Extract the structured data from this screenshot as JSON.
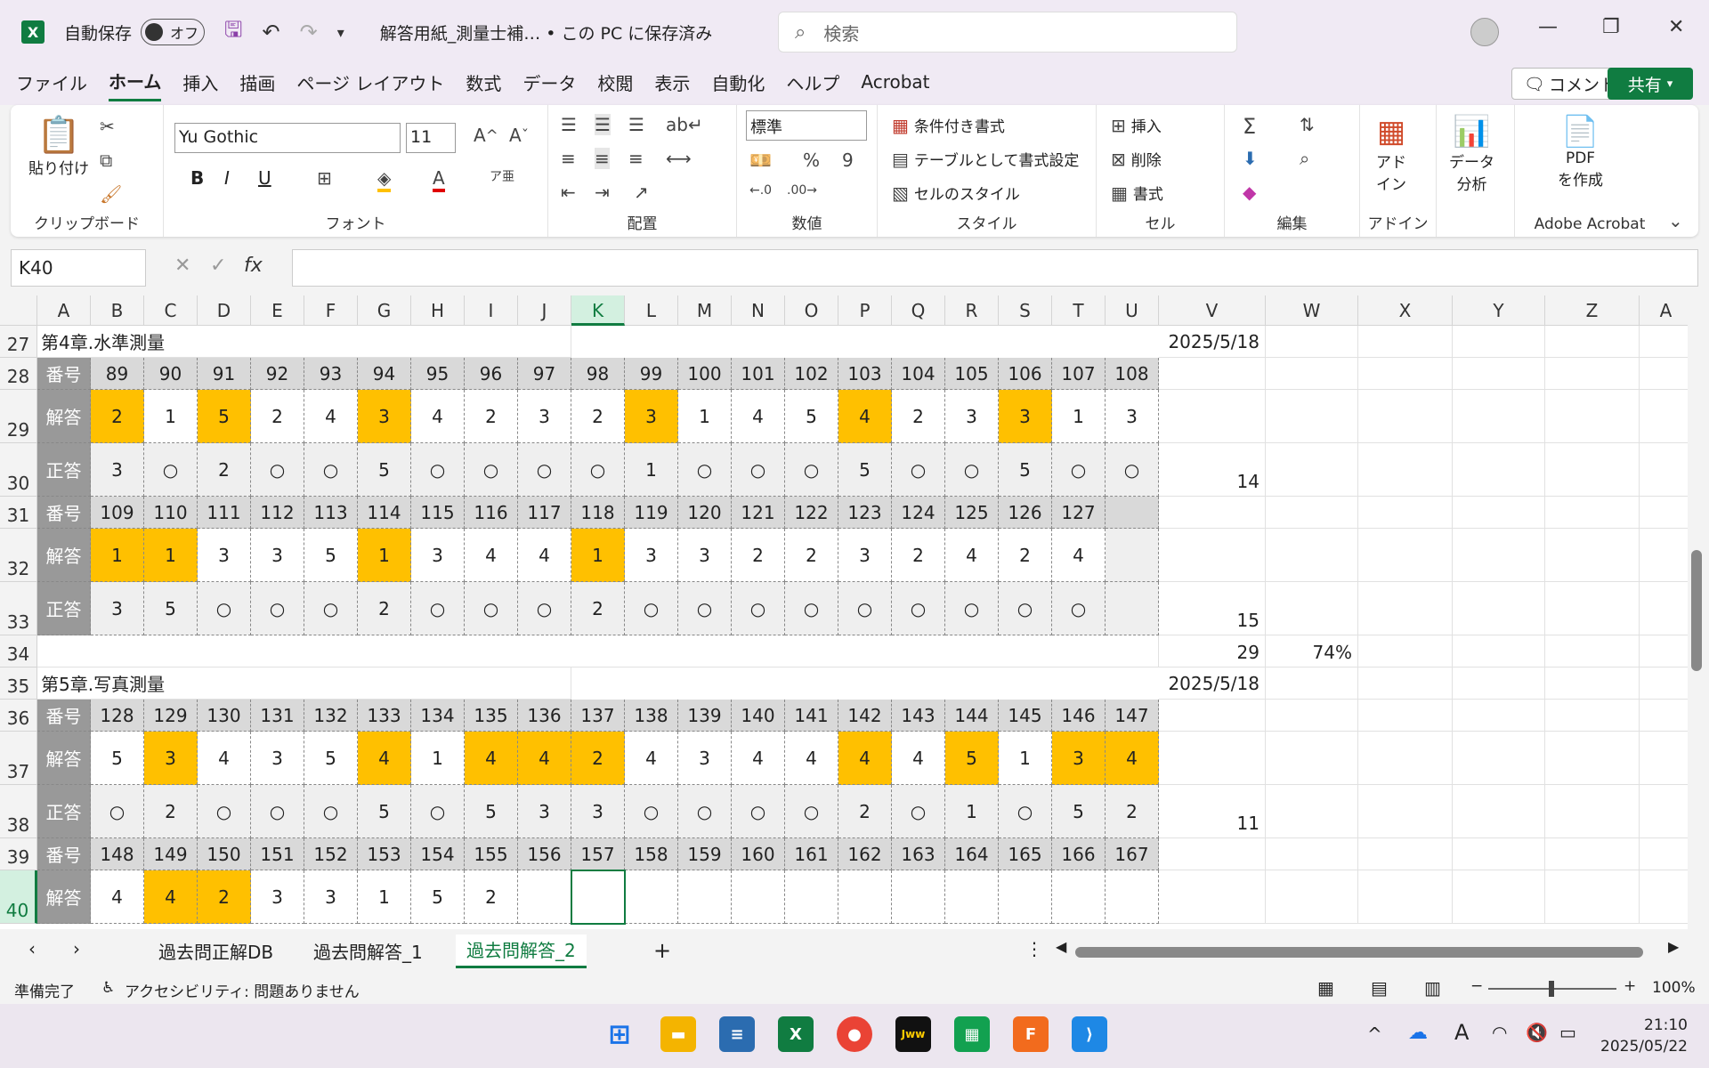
{
  "titlebar": {
    "app_icon": "X",
    "autosave_label": "自動保存",
    "autosave_state": "オフ",
    "doc_title": "解答用紙_測量士補… • この PC に保存済み",
    "search_placeholder": "検索"
  },
  "menu": {
    "items": [
      "ファイル",
      "ホーム",
      "挿入",
      "描画",
      "ページ レイアウト",
      "数式",
      "データ",
      "校閲",
      "表示",
      "自動化",
      "ヘルプ",
      "Acrobat"
    ],
    "active": "ホーム",
    "comment_label": "コメント",
    "share_label": "共有"
  },
  "ribbon": {
    "clipboard": {
      "paste": "貼り付け",
      "label": "クリップボード"
    },
    "font": {
      "name": "Yu Gothic",
      "size": "11",
      "label": "フォント"
    },
    "alignment": {
      "label": "配置"
    },
    "number": {
      "format": "標準",
      "label": "数値"
    },
    "styles": {
      "conditional": "条件付き書式",
      "table": "テーブルとして書式設定",
      "cell_styles": "セルのスタイル",
      "label": "スタイル"
    },
    "cells": {
      "insert": "挿入",
      "delete": "削除",
      "format": "書式",
      "label": "セル"
    },
    "editing": {
      "label": "編集"
    },
    "addins": {
      "btn1": "アド",
      "btn2": "イン",
      "label": "アドイン"
    },
    "analysis": {
      "btn1": "データ",
      "btn2": "分析"
    },
    "acrobat": {
      "btn1": "PDF",
      "btn2": "を作成",
      "label": "Adobe Acrobat"
    }
  },
  "formula_bar": {
    "name_box": "K40",
    "fx": "fx",
    "formula": ""
  },
  "columns": [
    "A",
    "B",
    "C",
    "D",
    "E",
    "F",
    "G",
    "H",
    "I",
    "J",
    "K",
    "L",
    "M",
    "N",
    "O",
    "P",
    "Q",
    "R",
    "S",
    "T",
    "U",
    "V",
    "W",
    "X",
    "Y",
    "Z",
    "A"
  ],
  "selected_column": "K",
  "rows": {
    "r27": {
      "num": "27",
      "title": "第4章.水準測量",
      "date": "2025/5/18"
    },
    "r28": {
      "num": "28",
      "label": "番号",
      "values": [
        "89",
        "90",
        "91",
        "92",
        "93",
        "94",
        "95",
        "96",
        "97",
        "98",
        "99",
        "100",
        "101",
        "102",
        "103",
        "104",
        "105",
        "106",
        "107",
        "108"
      ]
    },
    "r29": {
      "num": "29",
      "label": "解答",
      "values": [
        "2",
        "1",
        "5",
        "2",
        "4",
        "3",
        "4",
        "2",
        "3",
        "2",
        "3",
        "1",
        "4",
        "5",
        "4",
        "2",
        "3",
        "3",
        "1",
        "3"
      ]
    },
    "r30": {
      "num": "30",
      "label": "正答",
      "values": [
        "3",
        "○",
        "2",
        "○",
        "○",
        "5",
        "○",
        "○",
        "○",
        "○",
        "1",
        "○",
        "○",
        "○",
        "5",
        "○",
        "○",
        "5",
        "○",
        "○"
      ],
      "v": "14"
    },
    "r31": {
      "num": "31",
      "label": "番号",
      "values": [
        "109",
        "110",
        "111",
        "112",
        "113",
        "114",
        "115",
        "116",
        "117",
        "118",
        "119",
        "120",
        "121",
        "122",
        "123",
        "124",
        "125",
        "126",
        "127",
        ""
      ]
    },
    "r32": {
      "num": "32",
      "label": "解答",
      "values": [
        "1",
        "1",
        "3",
        "3",
        "5",
        "1",
        "3",
        "4",
        "4",
        "1",
        "3",
        "3",
        "2",
        "2",
        "3",
        "2",
        "4",
        "2",
        "4",
        ""
      ]
    },
    "r33": {
      "num": "33",
      "label": "正答",
      "values": [
        "3",
        "5",
        "○",
        "○",
        "○",
        "2",
        "○",
        "○",
        "○",
        "2",
        "○",
        "○",
        "○",
        "○",
        "○",
        "○",
        "○",
        "○",
        "○",
        ""
      ],
      "v": "15"
    },
    "r34": {
      "num": "34",
      "v": "29",
      "w": "74%"
    },
    "r35": {
      "num": "35",
      "title": "第5章.写真測量",
      "date": "2025/5/18"
    },
    "r36": {
      "num": "36",
      "label": "番号",
      "values": [
        "128",
        "129",
        "130",
        "131",
        "132",
        "133",
        "134",
        "135",
        "136",
        "137",
        "138",
        "139",
        "140",
        "141",
        "142",
        "143",
        "144",
        "145",
        "146",
        "147"
      ]
    },
    "r37": {
      "num": "37",
      "label": "解答",
      "values": [
        "5",
        "3",
        "4",
        "3",
        "5",
        "4",
        "1",
        "4",
        "4",
        "2",
        "4",
        "3",
        "4",
        "4",
        "4",
        "4",
        "5",
        "1",
        "3",
        "4"
      ]
    },
    "r38": {
      "num": "38",
      "label": "正答",
      "values": [
        "○",
        "2",
        "○",
        "○",
        "○",
        "5",
        "○",
        "5",
        "3",
        "3",
        "○",
        "○",
        "○",
        "○",
        "2",
        "○",
        "1",
        "○",
        "5",
        "2"
      ],
      "v": "11"
    },
    "r39": {
      "num": "39",
      "label": "番号",
      "values": [
        "148",
        "149",
        "150",
        "151",
        "152",
        "153",
        "154",
        "155",
        "156",
        "157",
        "158",
        "159",
        "160",
        "161",
        "162",
        "163",
        "164",
        "165",
        "166",
        "167"
      ]
    },
    "r40": {
      "num": "40",
      "label": "解答",
      "values": [
        "4",
        "4",
        "2",
        "3",
        "3",
        "1",
        "5",
        "2",
        "",
        "",
        "",
        "",
        "",
        "",
        "",
        "",
        "",
        "",
        "",
        ""
      ]
    }
  },
  "highlights": {
    "r29": [
      0,
      2,
      5,
      10,
      14,
      17
    ],
    "r32": [
      0,
      1,
      5,
      9
    ],
    "r37": [
      1,
      5,
      7,
      8,
      9,
      14,
      16,
      18,
      19
    ],
    "r40": [
      1,
      2
    ]
  },
  "sheets": {
    "tabs": [
      "過去問正解DB",
      "過去問解答_1",
      "過去問解答_2"
    ],
    "active": "過去問解答_2"
  },
  "status": {
    "ready": "準備完了",
    "accessibility": "アクセシビリティ: 問題ありません",
    "zoom": "100%"
  },
  "clock": {
    "time": "21:10",
    "date": "2025/05/22"
  },
  "colors": {
    "accent": "#107c41",
    "highlight": "#ffc000",
    "label_bg": "#999999",
    "header_bg": "#d9d9d9"
  }
}
